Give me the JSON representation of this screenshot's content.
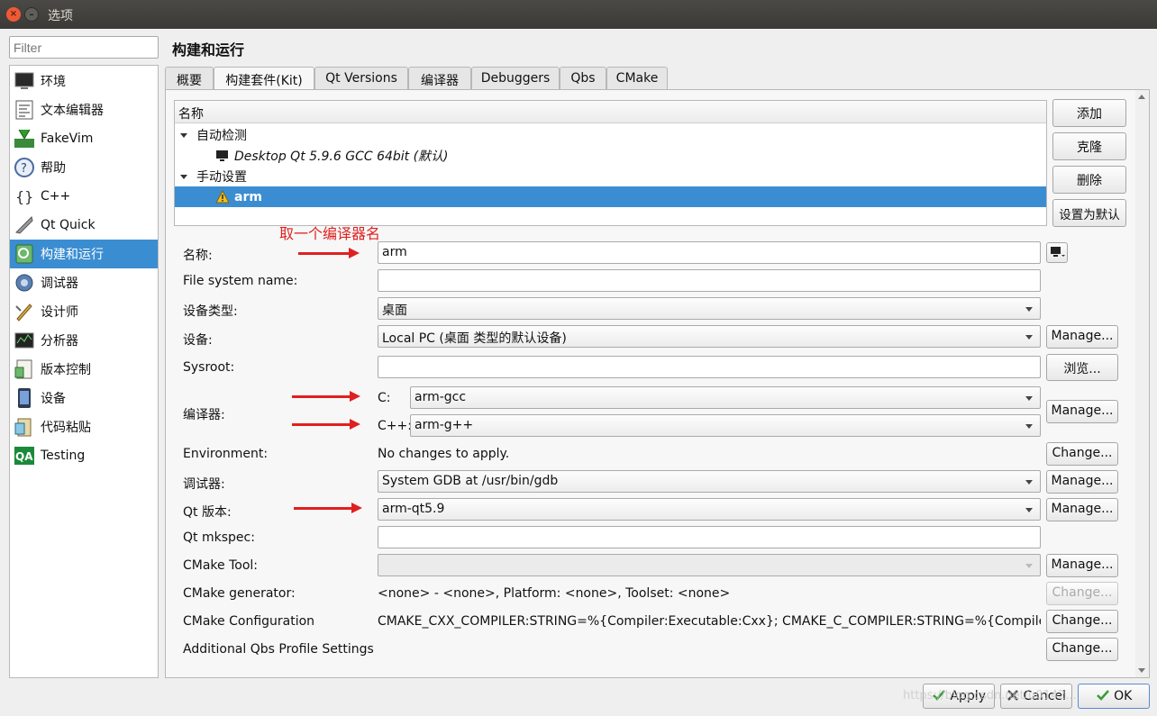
{
  "window": {
    "title": "选项",
    "close_glyph": "×",
    "min_glyph": "–"
  },
  "filter": {
    "placeholder": "Filter"
  },
  "sidebar": {
    "items": [
      {
        "label": "环境",
        "icon": "monitor-icon"
      },
      {
        "label": "文本编辑器",
        "icon": "text-editor-icon"
      },
      {
        "label": "FakeVim",
        "icon": "fakevim-icon"
      },
      {
        "label": "帮助",
        "icon": "help-icon"
      },
      {
        "label": "C++",
        "icon": "cpp-icon"
      },
      {
        "label": "Qt Quick",
        "icon": "qt-quick-icon"
      },
      {
        "label": "构建和运行",
        "icon": "build-run-icon"
      },
      {
        "label": "调试器",
        "icon": "debugger-icon"
      },
      {
        "label": "设计师",
        "icon": "designer-icon"
      },
      {
        "label": "分析器",
        "icon": "analyzer-icon"
      },
      {
        "label": "版本控制",
        "icon": "version-control-icon"
      },
      {
        "label": "设备",
        "icon": "device-icon"
      },
      {
        "label": "代码粘贴",
        "icon": "code-paste-icon"
      },
      {
        "label": "Testing",
        "icon": "testing-icon"
      }
    ]
  },
  "page_title": "构建和运行",
  "tabs": [
    "概要",
    "构建套件(Kit)",
    "Qt Versions",
    "编译器",
    "Debuggers",
    "Qbs",
    "CMake"
  ],
  "kits": {
    "header": "名称",
    "auto_group": "自动检测",
    "auto_kit": "Desktop Qt 5.9.6 GCC 64bit (默认)",
    "manual_group": "手动设置",
    "manual_kit": "arm"
  },
  "kit_buttons": {
    "add": "添加",
    "clone": "克隆",
    "delete": "删除",
    "set_default": "设置为默认"
  },
  "annotation": "取一个编译器名",
  "form": {
    "name_label": "名称:",
    "name_value": "arm",
    "fs_label": "File system name:",
    "fs_value": "",
    "device_type_label": "设备类型:",
    "device_type_value": "桌面",
    "device_label": "设备:",
    "device_value": "Local PC (桌面 类型的默认设备)",
    "sysroot_label": "Sysroot:",
    "sysroot_value": "",
    "compiler_label": "编译器:",
    "c_label": "C:",
    "c_value": "arm-gcc",
    "cpp_label": "C++:",
    "cpp_value": "arm-g++",
    "env_label": "Environment:",
    "env_value": "No changes to apply.",
    "debugger_label": "调试器:",
    "debugger_value": "System GDB at /usr/bin/gdb",
    "qt_label": "Qt 版本:",
    "qt_value": "arm-qt5.9",
    "mkspec_label": "Qt mkspec:",
    "mkspec_value": "",
    "cmake_tool_label": "CMake Tool:",
    "cmake_tool_value": "",
    "cmake_gen_label": "CMake generator:",
    "cmake_gen_value": "<none> - <none>, Platform: <none>, Toolset: <none>",
    "cmake_conf_label": "CMake Configuration",
    "cmake_conf_value": "CMAKE_CXX_COMPILER:STRING=%{Compiler:Executable:Cxx}; CMAKE_C_COMPILER:STRING=%{Compiler:…",
    "qbs_label": "Additional Qbs Profile Settings"
  },
  "side_buttons": {
    "manage": "Manage...",
    "browse": "浏览...",
    "change": "Change..."
  },
  "bottom": {
    "apply": "Apply",
    "cancel": "Cancel",
    "ok": "OK"
  },
  "watermark": "https://blog.csdn.net/u0142..."
}
